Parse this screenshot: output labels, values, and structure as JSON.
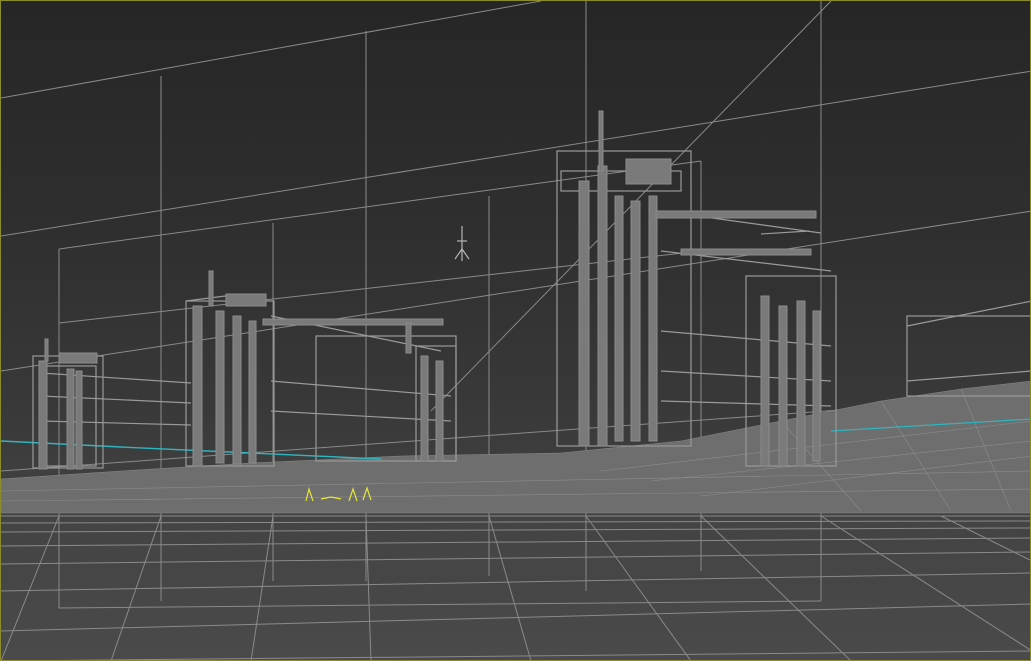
{
  "viewport": {
    "name": "perspective-viewport",
    "colors": {
      "background_top": "#262626",
      "background_bottom": "#4a4a4a",
      "border": "#8c8c2a",
      "grid": "#8a8a8a",
      "wireframe": "#9a9a9a",
      "geometry": "#7a7a7a",
      "spline_cyan": "#2fb5c0",
      "selected_yellow": "#e6e63a"
    }
  }
}
